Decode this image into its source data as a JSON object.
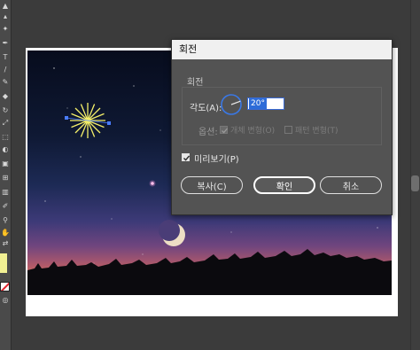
{
  "dialog": {
    "title": "회전",
    "group_title": "회전",
    "angle_label": "각도(A):",
    "angle_value": "20°",
    "angle_degrees": 20,
    "options_label": "옵션:",
    "option_transform_objects": "개체 변형(O)",
    "option_transform_patterns": "패턴 변형(T)",
    "preview_label": "미리보기(P)",
    "copy_button": "복사(C)",
    "ok_button": "확인",
    "cancel_button": "취소"
  },
  "colors": {
    "fill": "#f1f093",
    "dialog_bg": "#535353",
    "accent": "#2d6cd8"
  }
}
